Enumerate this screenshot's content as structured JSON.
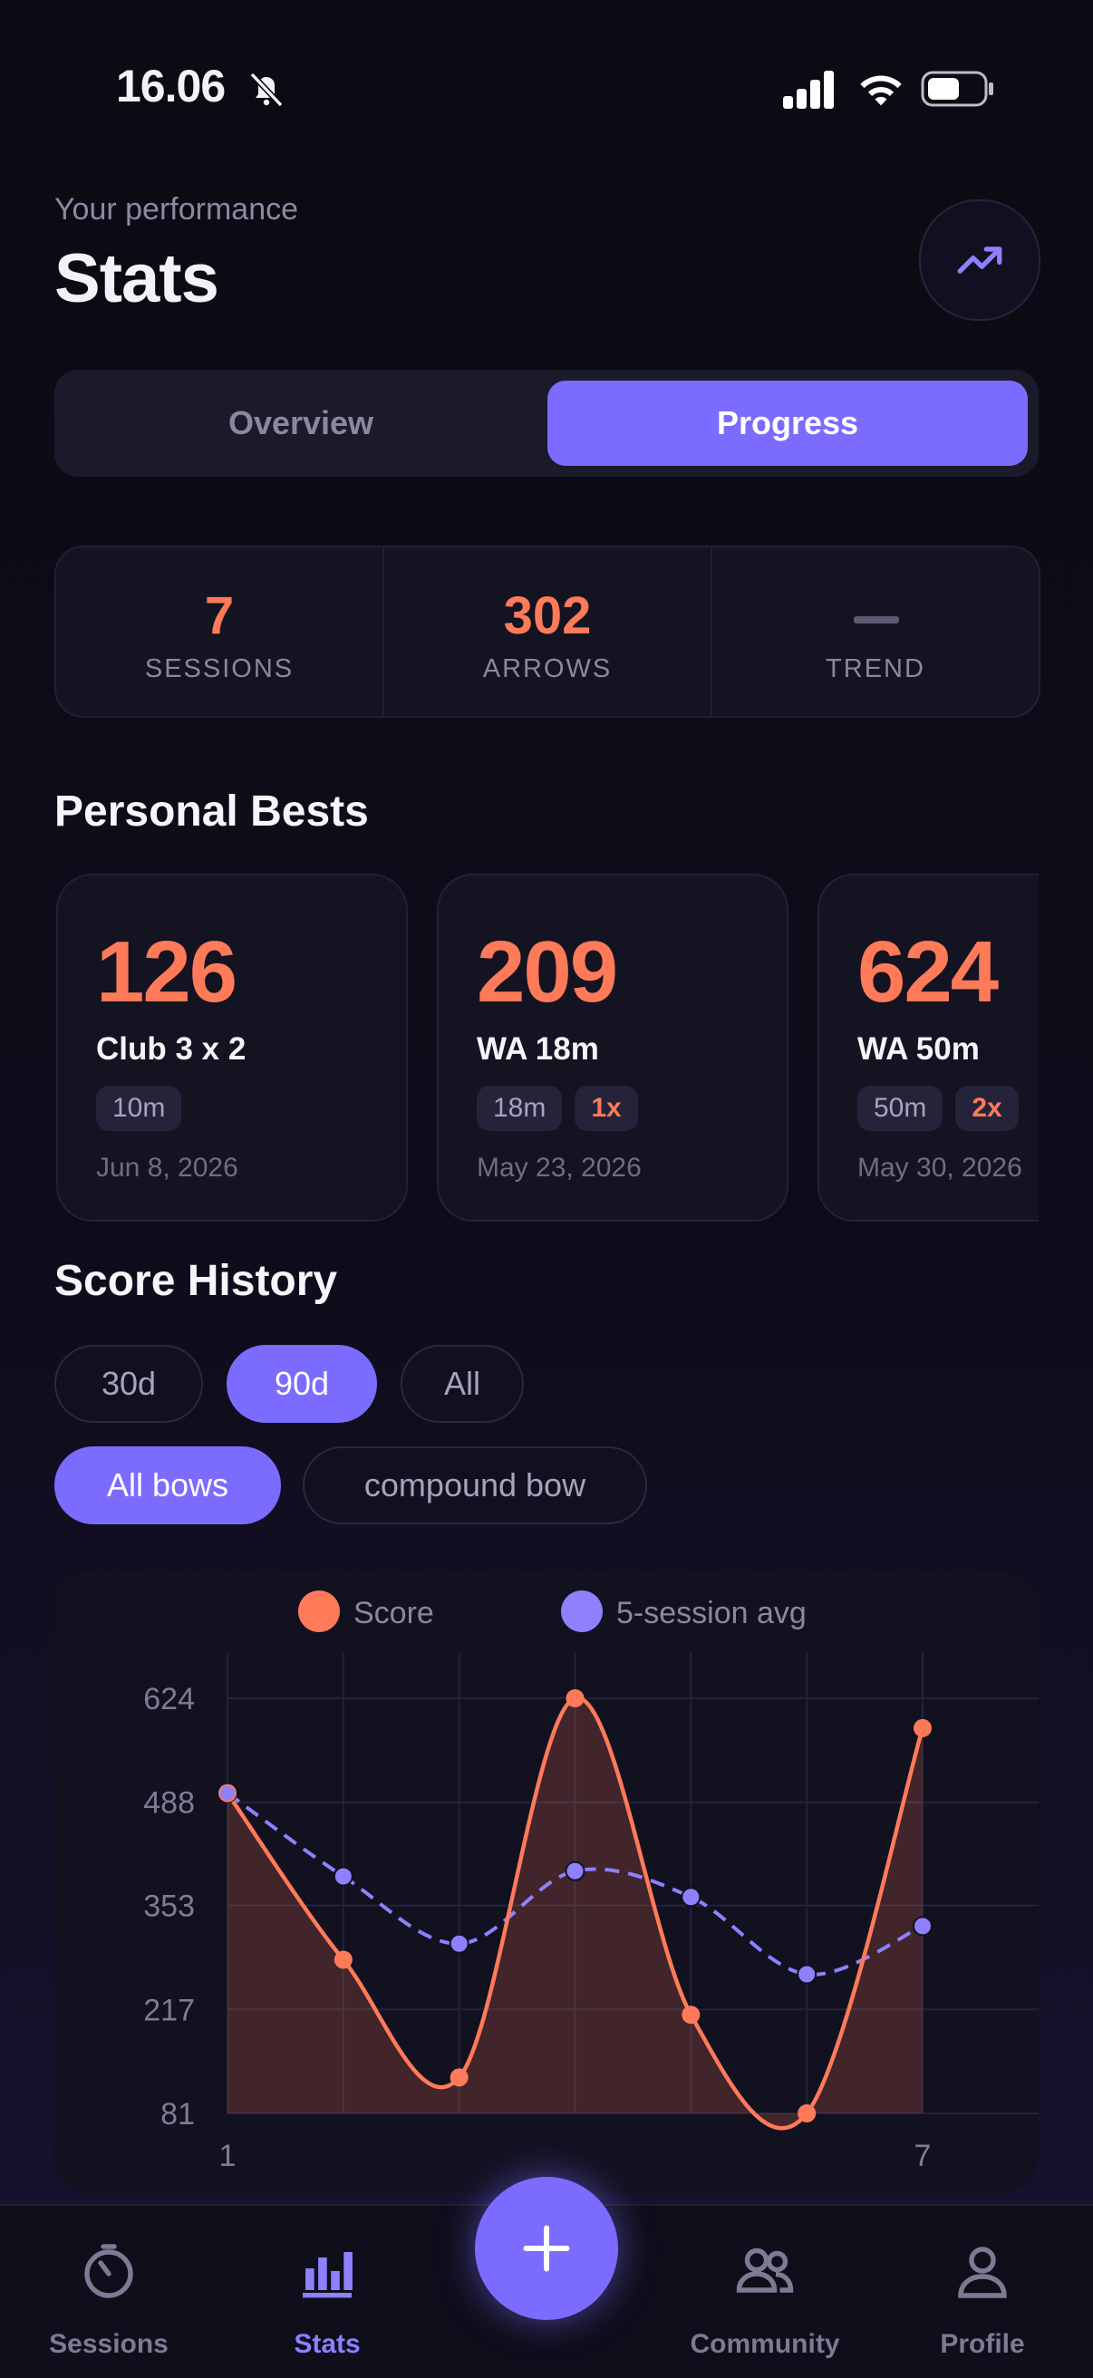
{
  "status_bar": {
    "time": "16.06",
    "bell_icon": "bell-slash-icon",
    "signal_icon": "signal-icon",
    "wifi_icon": "wifi-icon",
    "battery_icon": "battery-icon"
  },
  "header": {
    "subtitle": "Your performance",
    "title": "Stats",
    "action_icon": "trending-up-icon"
  },
  "tabs": [
    {
      "label": "Overview",
      "active": false
    },
    {
      "label": "Progress",
      "active": true
    }
  ],
  "summary": [
    {
      "value": "7",
      "label": "SESSIONS"
    },
    {
      "value": "302",
      "label": "ARROWS"
    },
    {
      "value": "",
      "label": "TREND",
      "icon": "dash-icon"
    }
  ],
  "personal_bests": {
    "title": "Personal Bests",
    "cards": [
      {
        "score": "126",
        "name": "Club 3 x 2",
        "tags": [
          "10m"
        ],
        "badge": "",
        "date": "Jun 8, 2026"
      },
      {
        "score": "209",
        "name": "WA 18m",
        "tags": [
          "18m"
        ],
        "badge": "1x",
        "date": "May 23, 2026"
      },
      {
        "score": "624",
        "name": "WA 50m",
        "tags": [
          "50m"
        ],
        "badge": "2x",
        "date": "May 30, 2026"
      }
    ]
  },
  "score_history": {
    "title": "Score History",
    "ranges": [
      {
        "label": "30d",
        "active": false
      },
      {
        "label": "90d",
        "active": true
      },
      {
        "label": "All",
        "active": false
      }
    ],
    "bows": [
      {
        "label": "All bows",
        "active": true
      },
      {
        "label": "compound bow",
        "active": false
      }
    ]
  },
  "chart_data": {
    "type": "line",
    "legend": [
      "Score",
      "5-session avg"
    ],
    "x": [
      1,
      2,
      3,
      4,
      5,
      6,
      7
    ],
    "x_tick_labels": [
      "1",
      "7"
    ],
    "y_ticks": [
      624,
      488,
      353,
      217,
      81
    ],
    "ylim": [
      81,
      624
    ],
    "grid": true,
    "series": [
      {
        "name": "Score",
        "color": "#ff7a59",
        "style": "solid",
        "values": [
          500,
          282,
          128,
          624,
          210,
          81,
          585
        ]
      },
      {
        "name": "5-session avg",
        "color": "#8e80ff",
        "style": "dashed",
        "values": [
          500,
          391,
          303,
          398,
          364,
          263,
          326
        ]
      }
    ]
  },
  "bottom_nav": {
    "items": [
      {
        "label": "Sessions",
        "icon": "timer-icon",
        "active": false
      },
      {
        "label": "Stats",
        "icon": "bar-chart-icon",
        "active": true
      },
      {
        "label": "Community",
        "icon": "users-icon",
        "active": false
      },
      {
        "label": "Profile",
        "icon": "person-icon",
        "active": false
      }
    ],
    "fab_icon": "plus-icon"
  },
  "colors": {
    "accent": "#7b6cff",
    "score": "#ff7a59",
    "background": "#0b0b13"
  }
}
